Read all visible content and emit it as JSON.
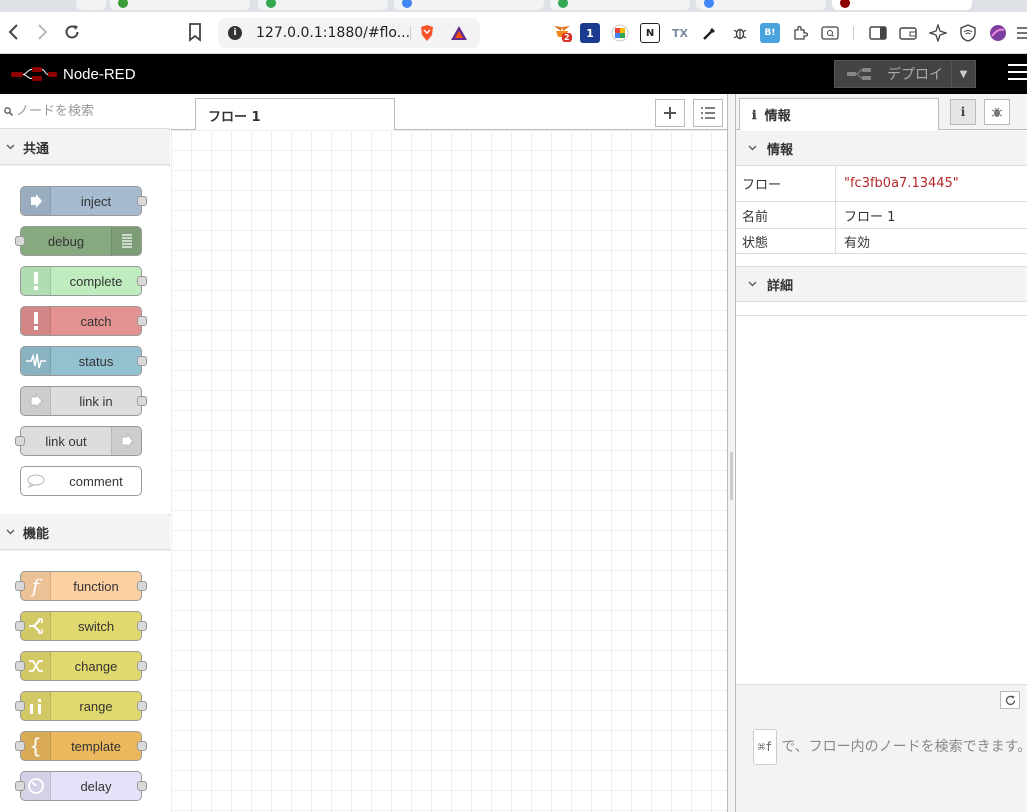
{
  "browser": {
    "url": "127.0.0.1:1880/#flo...",
    "extension_badge": "2"
  },
  "app": {
    "title": "Node-RED",
    "deploy_label": "デプロイ"
  },
  "palette": {
    "search_placeholder": "ノードを検索",
    "categories": [
      {
        "label": "共通",
        "nodes": [
          {
            "label": "inject",
            "color": "#a6bbcf"
          },
          {
            "label": "debug",
            "color": "#87a980"
          },
          {
            "label": "complete",
            "color": "#c0edc0"
          },
          {
            "label": "catch",
            "color": "#e49191"
          },
          {
            "label": "status",
            "color": "#94c1d0"
          },
          {
            "label": "link in",
            "color": "#dddddd"
          },
          {
            "label": "link out",
            "color": "#dddddd"
          },
          {
            "label": "comment",
            "color": "#ffffff"
          }
        ]
      },
      {
        "label": "機能",
        "nodes": [
          {
            "label": "function",
            "color": "#fdd0a2"
          },
          {
            "label": "switch",
            "color": "#e2d96e"
          },
          {
            "label": "change",
            "color": "#e2d96e"
          },
          {
            "label": "range",
            "color": "#e2d96e"
          },
          {
            "label": "template",
            "color": "#ebb85d"
          },
          {
            "label": "delay",
            "color": "#e6e0f8"
          }
        ]
      }
    ]
  },
  "workspace": {
    "tab_label": "フロー 1"
  },
  "sidebar": {
    "tab_label": "情報",
    "section_info": "情報",
    "section_details": "詳細",
    "properties": [
      {
        "key": "フロー",
        "value": "\"fc3fb0a7.13445\""
      },
      {
        "key": "名前",
        "value": "フロー 1"
      },
      {
        "key": "状態",
        "value": "有効"
      }
    ],
    "hint_key": "⌘f",
    "hint_text": "で、フロー内のノードを検索できます。"
  }
}
